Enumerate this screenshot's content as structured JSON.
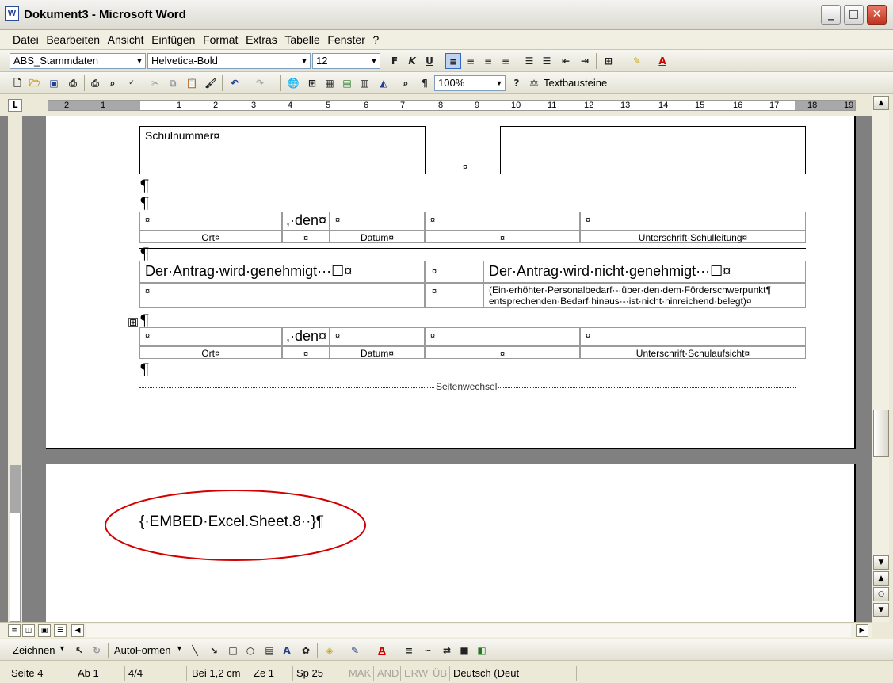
{
  "window": {
    "icon": "W",
    "title": "Dokument3 - Microsoft Word"
  },
  "menu": [
    "Datei",
    "Bearbeiten",
    "Ansicht",
    "Einfügen",
    "Format",
    "Extras",
    "Tabelle",
    "Fenster",
    "?"
  ],
  "format_toolbar": {
    "style": "ABS_Stammdaten",
    "font": "Helvetica-Bold",
    "size": "12",
    "bold": "F",
    "italic": "K",
    "underline": "U"
  },
  "standard_toolbar": {
    "zoom": "100%",
    "pilcrow": "¶",
    "textbausteine": "Textbausteine"
  },
  "ruler": {
    "tab_selector": "L",
    "numbers": [
      "2",
      "1",
      "1",
      "2",
      "3",
      "4",
      "5",
      "6",
      "7",
      "8",
      "9",
      "10",
      "11",
      "12",
      "13",
      "14",
      "15",
      "16",
      "17",
      "18",
      "19"
    ]
  },
  "document": {
    "schulnummer": "Schulnummer¤",
    "cell_mark": "¤",
    "pilcrow": "¶",
    "den": ",·den¤",
    "ort": "Ort¤",
    "datum": "Datum¤",
    "unterschrift_schulleitung": "Unterschrift·Schulleitung¤",
    "genehmigt": "Der·Antrag·wird·genehmigt···☐¤",
    "nicht_genehmigt": "Der·Antrag·wird·nicht·genehmigt···☐¤",
    "hinweis_line1": "(Ein·erhöhter·Personalbedarf·-·über·den·dem·Förderschwerpunkt¶",
    "hinweis_line2": "entsprechenden·Bedarf·hinaus·-·ist·nicht·hinreichend·belegt)¤",
    "unterschrift_schulaufsicht": "Unterschrift·Schulaufsicht¤",
    "seitenwechsel": "Seitenwechsel",
    "embed_field": "{·EMBED·Excel.Sheet.8··}¶",
    "table_move_handle": "⊞"
  },
  "draw_toolbar": {
    "zeichnen": "Zeichnen",
    "autoformen": "AutoFormen"
  },
  "status": {
    "seite": "Seite 4",
    "ab": "Ab 1",
    "pages": "4/4",
    "bei": "Bei 1,2 cm",
    "ze": "Ze 1",
    "sp": "Sp 25",
    "mak": "MAK",
    "and": "AND",
    "erw": "ERW",
    "ub": "ÜB",
    "language": "Deutsch (Deut"
  },
  "colors": {
    "highlight_circle": "#d40000",
    "close_button": "#c0341e"
  }
}
